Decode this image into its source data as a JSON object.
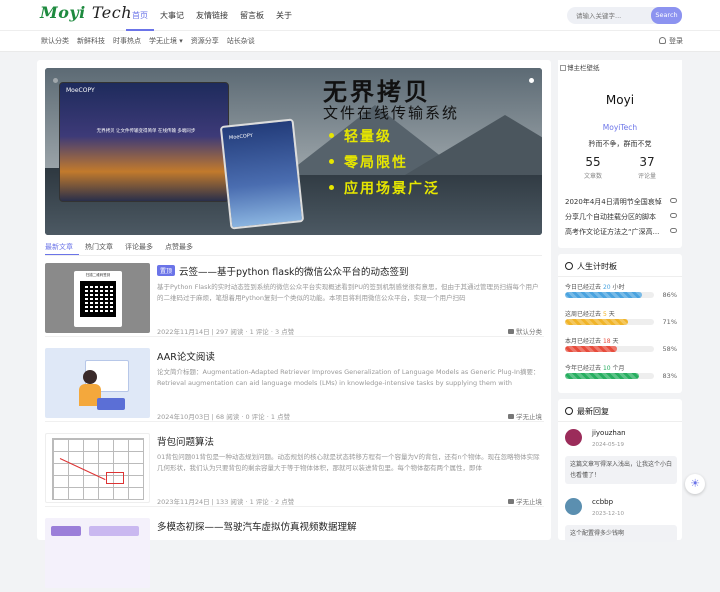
{
  "site": {
    "logo_main": "Moyi",
    "logo_sub": "Tech"
  },
  "nav": [
    {
      "label": "首页",
      "active": true
    },
    {
      "label": "大事记"
    },
    {
      "label": "友情链接"
    },
    {
      "label": "留言板"
    },
    {
      "label": "关于"
    }
  ],
  "search": {
    "placeholder": "请输入关键字...",
    "button": "Search"
  },
  "subnav": [
    {
      "label": "默认分类"
    },
    {
      "label": "新鲜科技"
    },
    {
      "label": "时事热点"
    },
    {
      "label": "学无止境 ▾"
    },
    {
      "label": "资源分享"
    },
    {
      "label": "站长杂谈"
    }
  ],
  "login": "登录",
  "banner": {
    "title": "无界拷贝",
    "subtitle": "文件在线传输系统",
    "features": [
      "轻量级",
      "零局限性",
      "应用场景广泛"
    ],
    "card1_title": "MoeCOPY",
    "card1_text": "无界拷贝 让文件传输变得简单 在线传输 多端同步",
    "card2_title": "MoeCOPY"
  },
  "tabs": [
    "最新文章",
    "热门文章",
    "评论最多",
    "点赞最多"
  ],
  "posts": [
    {
      "badge": "置顶",
      "title": "云签——基于python flask的微信公众平台的动态签到",
      "excerpt": "基于Python Flask的实时动态签到系统的微信公众平台实现概述看到PU的签到机制感觉很有意思，但由于其通过管理员扫描每个用户的二维码过于麻烦，笔想着用Python复刻一个类似的功能。本项目将利用微信公众平台，实现一个用户扫码",
      "date": "2022年11月14日",
      "reads": "297 阅读",
      "comments": "1 评论",
      "likes": "3 点赞",
      "category": "默认分类"
    },
    {
      "badge": "",
      "title": "AAR论文阅读",
      "excerpt": "论文简介标题：Augmentation-Adapted Retriever Improves Generalization of Language Models as Generic Plug-In摘要：Retrieval augmentation can aid language models (LMs) in knowledge-intensive tasks by supplying them with external...",
      "date": "2024年10月03日",
      "reads": "68 阅读",
      "comments": "0 评论",
      "likes": "1 点赞",
      "category": "学无止境"
    },
    {
      "badge": "",
      "title": "背包问题算法",
      "excerpt": "01背包问题01背包是一种动态规划问题。动态规划的核心就是状态转移方程有一个容量为V的背包，还有n个物体。现在忽略物体实际几何形状，我们认为只要背包的剩余容量大于等于物体体积，那就可以装进背包里。每个物体都有两个属性，即体",
      "date": "2023年11月24日",
      "reads": "133 阅读",
      "comments": "1 评论",
      "likes": "2 点赞",
      "category": "学无止境"
    },
    {
      "badge": "",
      "title": "多模态初探——驾驶汽车虚拟仿真视频数据理解",
      "excerpt": "",
      "date": "",
      "reads": "",
      "comments": "",
      "likes": "",
      "category": ""
    }
  ],
  "thumb_labels": {
    "qr_caption": "扫描二维码签到"
  },
  "profile": {
    "bg_alt": "博主栏壁纸",
    "name": "Moyi",
    "nickname": "MoyiTech",
    "motto": "矜而不争，群而不党",
    "articles_count": "55",
    "articles_label": "文章数",
    "comments_count": "37",
    "comments_label": "评论量",
    "links": [
      "2020年4月4日清明节全国哀悼",
      "分享几个自动挂载分区的脚本",
      "高考作文论证方法之“广深高..."
    ]
  },
  "life_timer": {
    "title": "人生计时板",
    "rows": [
      {
        "prefix": "今日已经过去",
        "value": "20",
        "unit": "小时",
        "percent": 86,
        "pct_label": "86%",
        "color": "#4aa3df"
      },
      {
        "prefix": "这周已经过去",
        "value": "5",
        "unit": "天",
        "percent": 71,
        "pct_label": "71%",
        "color": "#f0b429"
      },
      {
        "prefix": "本月已经过去",
        "value": "18",
        "unit": "天",
        "percent": 58,
        "pct_label": "58%",
        "color": "#e74c3c"
      },
      {
        "prefix": "今年已经过去",
        "value": "10",
        "unit": "个月",
        "percent": 83,
        "pct_label": "83%",
        "color": "#27ae60"
      }
    ]
  },
  "replies": {
    "title": "最新回复",
    "items": [
      {
        "name": "jiyouzhan",
        "date": "2024-05-19",
        "body": "这篇文章写得深入浅出，让我这个小白也看懂了！",
        "avatar_color": "#9b2c5a"
      },
      {
        "name": "ccbbp",
        "date": "2023-12-10",
        "body": "这个配置得多少钱啊",
        "avatar_color": "#5b8fb0"
      }
    ]
  },
  "theme_toggle": "☀"
}
